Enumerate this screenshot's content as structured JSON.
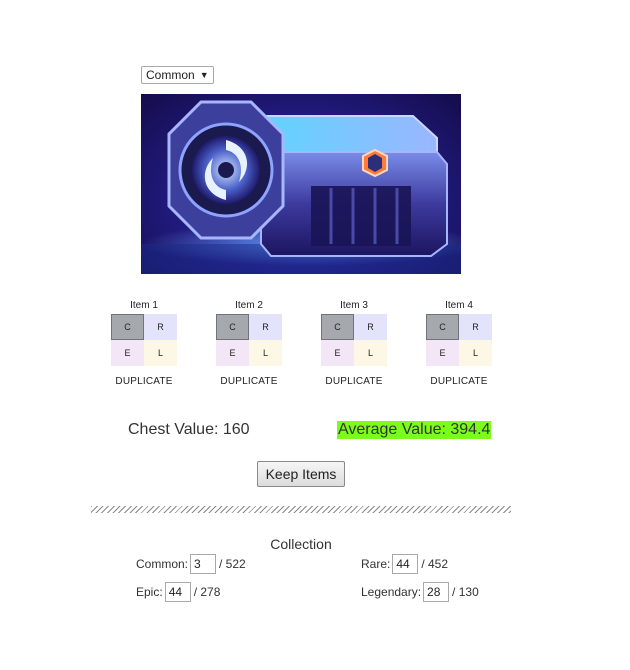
{
  "selector": {
    "selected": "Common",
    "arrow_icon": "triangle-down-icon"
  },
  "chest": {
    "image_icon": "loot-chest-image"
  },
  "items": [
    {
      "title": "Item 1",
      "cells": [
        "C",
        "R",
        "E",
        "L"
      ],
      "status": "DUPLICATE"
    },
    {
      "title": "Item 2",
      "cells": [
        "C",
        "R",
        "E",
        "L"
      ],
      "status": "DUPLICATE"
    },
    {
      "title": "Item 3",
      "cells": [
        "C",
        "R",
        "E",
        "L"
      ],
      "status": "DUPLICATE"
    },
    {
      "title": "Item 4",
      "cells": [
        "C",
        "R",
        "E",
        "L"
      ],
      "status": "DUPLICATE"
    }
  ],
  "values": {
    "chest": "Chest Value: 160",
    "average": "Average Value: 394.4"
  },
  "actions": {
    "keep_label": "Keep Items"
  },
  "collection": {
    "title": "Collection",
    "common": {
      "label": "Common:",
      "value": "3",
      "total": "/ 522"
    },
    "rare": {
      "label": "Rare:",
      "value": "44",
      "total": "/ 452"
    },
    "epic": {
      "label": "Epic:",
      "value": "44",
      "total": "/ 278"
    },
    "legendary": {
      "label": "Legendary:",
      "value": "28",
      "total": "/ 130"
    }
  },
  "colors": {
    "average_highlight": "#7cfc1c",
    "cell_common": "#a5a9ae",
    "cell_rare": "#e3e3fb",
    "cell_epic": "#f3e6f7",
    "cell_legendary": "#fdf7e6"
  }
}
